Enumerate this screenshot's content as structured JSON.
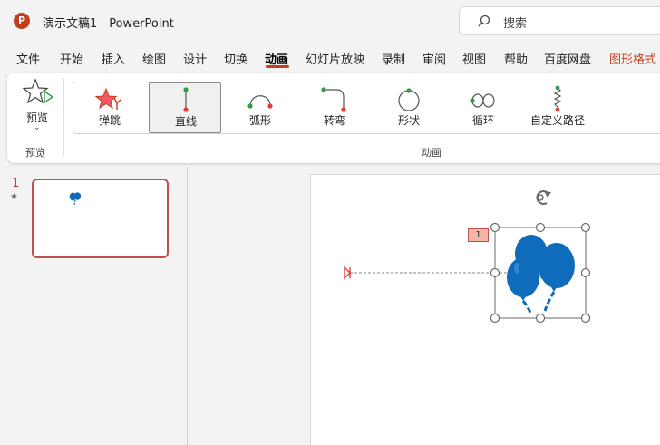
{
  "titlebar": {
    "app_icon": "powerpoint-logo",
    "app_icon_letter": "P",
    "title": "演示文稿1  -  PowerPoint",
    "search_placeholder": "搜索",
    "search_icon": "search-icon"
  },
  "menu": {
    "items": [
      "文件",
      "开始",
      "插入",
      "绘图",
      "设计",
      "切换",
      "动画",
      "幻灯片放映",
      "录制",
      "审阅",
      "视图",
      "帮助",
      "百度网盘",
      "图形格式"
    ],
    "active": "动画",
    "contextual": "图形格式"
  },
  "ribbon": {
    "preview": {
      "label": "预览",
      "icon": "star-preview-icon",
      "chevron": "⌄",
      "group_label": "预览"
    },
    "animation_group_label": "动画",
    "animations": [
      {
        "label": "弹跳",
        "icon": "bounce-star-icon",
        "selected": false
      },
      {
        "label": "直线",
        "icon": "line-path-icon",
        "selected": true
      },
      {
        "label": "弧形",
        "icon": "arc-path-icon",
        "selected": false
      },
      {
        "label": "转弯",
        "icon": "turn-path-icon",
        "selected": false
      },
      {
        "label": "形状",
        "icon": "shape-path-icon",
        "selected": false
      },
      {
        "label": "循环",
        "icon": "loop-path-icon",
        "selected": false
      },
      {
        "label": "自定义路径",
        "icon": "custom-path-icon",
        "selected": false
      }
    ]
  },
  "slides_pane": {
    "slide_number": "1",
    "animation_marker": "★"
  },
  "canvas": {
    "animation_order_badge": "1",
    "selected_object": "balloons-icon",
    "motion_path": "straight-line-path",
    "colors": {
      "accent": "#c43e1c",
      "balloon": "#0f6cbd",
      "path_end": "#e03b3b",
      "path_start": "#7dc04b"
    }
  }
}
